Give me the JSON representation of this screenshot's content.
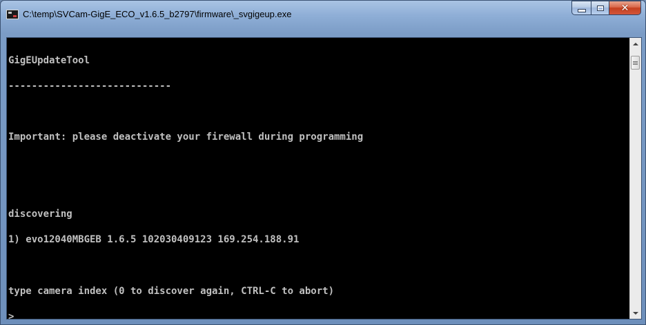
{
  "window": {
    "title": "C:\\temp\\SVCam-GigE_ECO_v1.6.5_b2797\\firmware\\_svgigeup.exe",
    "icon": "console-app-icon"
  },
  "caption_buttons": {
    "minimize": "minimize-icon",
    "maximize": "maximize-icon",
    "close": "close-icon"
  },
  "console": {
    "foreground": "#c0c0c0",
    "background": "#000000",
    "lines": [
      "GigEUpdateTool",
      "----------------------------",
      "",
      "Important: please deactivate your firewall during programming",
      "",
      "",
      "discovering",
      "1) evo12040MBGEB 1.6.5 102030409123 169.254.188.91",
      "",
      "type camera index (0 to discover again, CTRL-C to abort)",
      ">"
    ]
  },
  "scrollbar": {
    "up_icon": "scroll-up-arrow-icon",
    "down_icon": "scroll-down-arrow-icon"
  }
}
